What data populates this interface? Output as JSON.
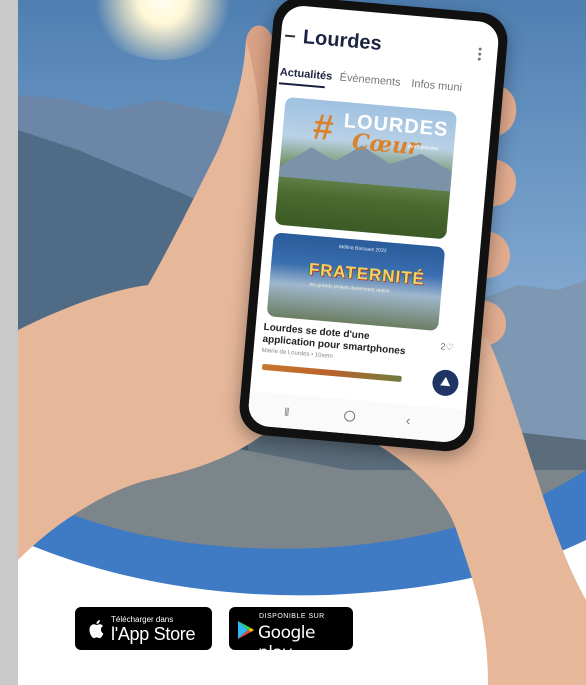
{
  "app": {
    "title": "Lourdes",
    "tabs": [
      {
        "label": "Actualités",
        "active": true
      },
      {
        "label": "Évènements",
        "active": false
      },
      {
        "label": "Infos muni",
        "active": false
      }
    ]
  },
  "feed": {
    "card1": {
      "logo_main": "LOURDES",
      "logo_script": "Cœur",
      "logo_sub": "des Pyrénées",
      "logo_hash": "#"
    },
    "card2": {
      "headline_art": "FRATERNITÉ",
      "small_text": "Mélina Bassaez 2022",
      "tagline": "les grands projets deviennent réalité"
    },
    "article": {
      "title": "Lourdes se dote d'une application pour smartphones",
      "meta": "Mairie de Lourdes • 10sem",
      "likes": "2♡"
    }
  },
  "icons": {
    "menu": "menu-icon",
    "kebab": "kebab-icon",
    "fab": "scroll-up-icon",
    "apple": "apple-icon",
    "google_play": "google-play-icon"
  },
  "badges": {
    "apple": {
      "small": "Télécharger dans",
      "big": "l'App Store"
    },
    "google": {
      "small": "DISPONIBLE SUR",
      "big": "Google play"
    }
  },
  "colors": {
    "sky": "#6f9ac6",
    "wave_blue": "#3f7ac4",
    "title_navy": "#1c2340",
    "fab": "#1f3563"
  }
}
